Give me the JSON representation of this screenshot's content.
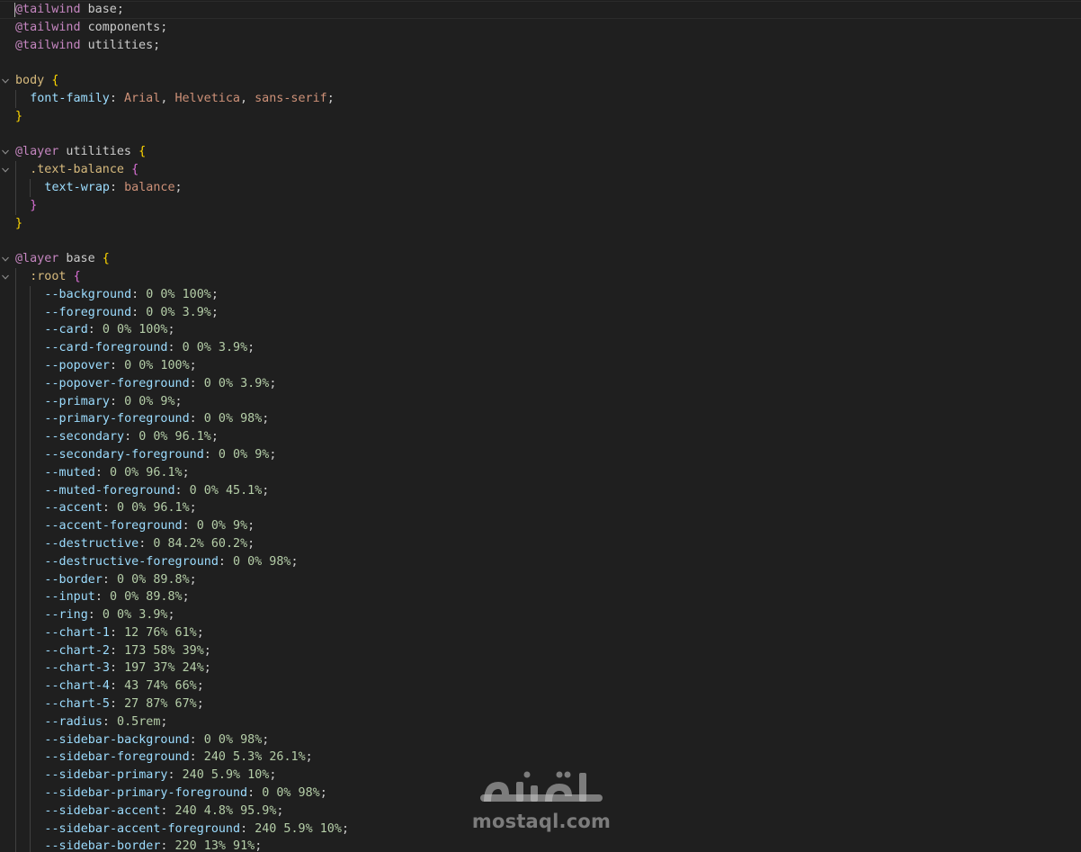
{
  "editor": {
    "language": "css",
    "colors": {
      "background": "#1f1f1f",
      "at_rule": "#c586c0",
      "selector": "#d7ba7d",
      "property": "#9cdcfe",
      "string_value": "#ce9178",
      "number": "#b5cea8",
      "bracket_level_1": "#ffd700",
      "bracket_level_2": "#da70d6"
    },
    "lines": [
      {
        "indent": 0,
        "fold": false,
        "cursor": true,
        "tokens": [
          {
            "t": "@tailwind",
            "c": "kw"
          },
          {
            "t": " base;",
            "c": "plain"
          }
        ]
      },
      {
        "indent": 0,
        "fold": false,
        "tokens": [
          {
            "t": "@tailwind",
            "c": "kw"
          },
          {
            "t": " components;",
            "c": "plain"
          }
        ]
      },
      {
        "indent": 0,
        "fold": false,
        "tokens": [
          {
            "t": "@tailwind",
            "c": "kw"
          },
          {
            "t": " utilities;",
            "c": "plain"
          }
        ]
      },
      {
        "indent": 0,
        "fold": false,
        "tokens": []
      },
      {
        "indent": 0,
        "fold": true,
        "tokens": [
          {
            "t": "body",
            "c": "sel"
          },
          {
            "t": " ",
            "c": "plain"
          },
          {
            "t": "{",
            "c": "b1"
          }
        ]
      },
      {
        "indent": 1,
        "fold": false,
        "tokens": [
          {
            "t": "font-family",
            "c": "prop"
          },
          {
            "t": ": ",
            "c": "plain"
          },
          {
            "t": "Arial",
            "c": "val"
          },
          {
            "t": ", ",
            "c": "plain"
          },
          {
            "t": "Helvetica",
            "c": "val"
          },
          {
            "t": ", ",
            "c": "plain"
          },
          {
            "t": "sans-serif",
            "c": "val"
          },
          {
            "t": ";",
            "c": "plain"
          }
        ]
      },
      {
        "indent": 0,
        "fold": false,
        "tokens": [
          {
            "t": "}",
            "c": "b1"
          }
        ]
      },
      {
        "indent": 0,
        "fold": false,
        "tokens": []
      },
      {
        "indent": 0,
        "fold": true,
        "tokens": [
          {
            "t": "@layer",
            "c": "kw"
          },
          {
            "t": " utilities ",
            "c": "plain"
          },
          {
            "t": "{",
            "c": "b1"
          }
        ]
      },
      {
        "indent": 1,
        "fold": true,
        "tokens": [
          {
            "t": ".text-balance",
            "c": "sel"
          },
          {
            "t": " ",
            "c": "plain"
          },
          {
            "t": "{",
            "c": "b2"
          }
        ]
      },
      {
        "indent": 2,
        "fold": false,
        "tokens": [
          {
            "t": "text-wrap",
            "c": "prop"
          },
          {
            "t": ": ",
            "c": "plain"
          },
          {
            "t": "balance",
            "c": "val"
          },
          {
            "t": ";",
            "c": "plain"
          }
        ]
      },
      {
        "indent": 1,
        "fold": false,
        "tokens": [
          {
            "t": "}",
            "c": "b2"
          }
        ]
      },
      {
        "indent": 0,
        "fold": false,
        "tokens": [
          {
            "t": "}",
            "c": "b1"
          }
        ]
      },
      {
        "indent": 0,
        "fold": false,
        "tokens": []
      },
      {
        "indent": 0,
        "fold": true,
        "tokens": [
          {
            "t": "@layer",
            "c": "kw"
          },
          {
            "t": " base ",
            "c": "plain"
          },
          {
            "t": "{",
            "c": "b1"
          }
        ]
      },
      {
        "indent": 1,
        "fold": true,
        "tokens": [
          {
            "t": ":root",
            "c": "sel"
          },
          {
            "t": " ",
            "c": "plain"
          },
          {
            "t": "{",
            "c": "b2"
          }
        ]
      },
      {
        "indent": 2,
        "fold": false,
        "tokens": [
          {
            "t": "--background",
            "c": "prop"
          },
          {
            "t": ": ",
            "c": "plain"
          },
          {
            "t": "0 0% 100%",
            "c": "num"
          },
          {
            "t": ";",
            "c": "plain"
          }
        ]
      },
      {
        "indent": 2,
        "fold": false,
        "tokens": [
          {
            "t": "--foreground",
            "c": "prop"
          },
          {
            "t": ": ",
            "c": "plain"
          },
          {
            "t": "0 0% 3.9%",
            "c": "num"
          },
          {
            "t": ";",
            "c": "plain"
          }
        ]
      },
      {
        "indent": 2,
        "fold": false,
        "tokens": [
          {
            "t": "--card",
            "c": "prop"
          },
          {
            "t": ": ",
            "c": "plain"
          },
          {
            "t": "0 0% 100%",
            "c": "num"
          },
          {
            "t": ";",
            "c": "plain"
          }
        ]
      },
      {
        "indent": 2,
        "fold": false,
        "tokens": [
          {
            "t": "--card-foreground",
            "c": "prop"
          },
          {
            "t": ": ",
            "c": "plain"
          },
          {
            "t": "0 0% 3.9%",
            "c": "num"
          },
          {
            "t": ";",
            "c": "plain"
          }
        ]
      },
      {
        "indent": 2,
        "fold": false,
        "tokens": [
          {
            "t": "--popover",
            "c": "prop"
          },
          {
            "t": ": ",
            "c": "plain"
          },
          {
            "t": "0 0% 100%",
            "c": "num"
          },
          {
            "t": ";",
            "c": "plain"
          }
        ]
      },
      {
        "indent": 2,
        "fold": false,
        "tokens": [
          {
            "t": "--popover-foreground",
            "c": "prop"
          },
          {
            "t": ": ",
            "c": "plain"
          },
          {
            "t": "0 0% 3.9%",
            "c": "num"
          },
          {
            "t": ";",
            "c": "plain"
          }
        ]
      },
      {
        "indent": 2,
        "fold": false,
        "tokens": [
          {
            "t": "--primary",
            "c": "prop"
          },
          {
            "t": ": ",
            "c": "plain"
          },
          {
            "t": "0 0% 9%",
            "c": "num"
          },
          {
            "t": ";",
            "c": "plain"
          }
        ]
      },
      {
        "indent": 2,
        "fold": false,
        "tokens": [
          {
            "t": "--primary-foreground",
            "c": "prop"
          },
          {
            "t": ": ",
            "c": "plain"
          },
          {
            "t": "0 0% 98%",
            "c": "num"
          },
          {
            "t": ";",
            "c": "plain"
          }
        ]
      },
      {
        "indent": 2,
        "fold": false,
        "tokens": [
          {
            "t": "--secondary",
            "c": "prop"
          },
          {
            "t": ": ",
            "c": "plain"
          },
          {
            "t": "0 0% 96.1%",
            "c": "num"
          },
          {
            "t": ";",
            "c": "plain"
          }
        ]
      },
      {
        "indent": 2,
        "fold": false,
        "tokens": [
          {
            "t": "--secondary-foreground",
            "c": "prop"
          },
          {
            "t": ": ",
            "c": "plain"
          },
          {
            "t": "0 0% 9%",
            "c": "num"
          },
          {
            "t": ";",
            "c": "plain"
          }
        ]
      },
      {
        "indent": 2,
        "fold": false,
        "tokens": [
          {
            "t": "--muted",
            "c": "prop"
          },
          {
            "t": ": ",
            "c": "plain"
          },
          {
            "t": "0 0% 96.1%",
            "c": "num"
          },
          {
            "t": ";",
            "c": "plain"
          }
        ]
      },
      {
        "indent": 2,
        "fold": false,
        "tokens": [
          {
            "t": "--muted-foreground",
            "c": "prop"
          },
          {
            "t": ": ",
            "c": "plain"
          },
          {
            "t": "0 0% 45.1%",
            "c": "num"
          },
          {
            "t": ";",
            "c": "plain"
          }
        ]
      },
      {
        "indent": 2,
        "fold": false,
        "tokens": [
          {
            "t": "--accent",
            "c": "prop"
          },
          {
            "t": ": ",
            "c": "plain"
          },
          {
            "t": "0 0% 96.1%",
            "c": "num"
          },
          {
            "t": ";",
            "c": "plain"
          }
        ]
      },
      {
        "indent": 2,
        "fold": false,
        "tokens": [
          {
            "t": "--accent-foreground",
            "c": "prop"
          },
          {
            "t": ": ",
            "c": "plain"
          },
          {
            "t": "0 0% 9%",
            "c": "num"
          },
          {
            "t": ";",
            "c": "plain"
          }
        ]
      },
      {
        "indent": 2,
        "fold": false,
        "tokens": [
          {
            "t": "--destructive",
            "c": "prop"
          },
          {
            "t": ": ",
            "c": "plain"
          },
          {
            "t": "0 84.2% 60.2%",
            "c": "num"
          },
          {
            "t": ";",
            "c": "plain"
          }
        ]
      },
      {
        "indent": 2,
        "fold": false,
        "tokens": [
          {
            "t": "--destructive-foreground",
            "c": "prop"
          },
          {
            "t": ": ",
            "c": "plain"
          },
          {
            "t": "0 0% 98%",
            "c": "num"
          },
          {
            "t": ";",
            "c": "plain"
          }
        ]
      },
      {
        "indent": 2,
        "fold": false,
        "tokens": [
          {
            "t": "--border",
            "c": "prop"
          },
          {
            "t": ": ",
            "c": "plain"
          },
          {
            "t": "0 0% 89.8%",
            "c": "num"
          },
          {
            "t": ";",
            "c": "plain"
          }
        ]
      },
      {
        "indent": 2,
        "fold": false,
        "tokens": [
          {
            "t": "--input",
            "c": "prop"
          },
          {
            "t": ": ",
            "c": "plain"
          },
          {
            "t": "0 0% 89.8%",
            "c": "num"
          },
          {
            "t": ";",
            "c": "plain"
          }
        ]
      },
      {
        "indent": 2,
        "fold": false,
        "tokens": [
          {
            "t": "--ring",
            "c": "prop"
          },
          {
            "t": ": ",
            "c": "plain"
          },
          {
            "t": "0 0% 3.9%",
            "c": "num"
          },
          {
            "t": ";",
            "c": "plain"
          }
        ]
      },
      {
        "indent": 2,
        "fold": false,
        "tokens": [
          {
            "t": "--chart-1",
            "c": "prop"
          },
          {
            "t": ": ",
            "c": "plain"
          },
          {
            "t": "12 76% 61%",
            "c": "num"
          },
          {
            "t": ";",
            "c": "plain"
          }
        ]
      },
      {
        "indent": 2,
        "fold": false,
        "tokens": [
          {
            "t": "--chart-2",
            "c": "prop"
          },
          {
            "t": ": ",
            "c": "plain"
          },
          {
            "t": "173 58% 39%",
            "c": "num"
          },
          {
            "t": ";",
            "c": "plain"
          }
        ]
      },
      {
        "indent": 2,
        "fold": false,
        "tokens": [
          {
            "t": "--chart-3",
            "c": "prop"
          },
          {
            "t": ": ",
            "c": "plain"
          },
          {
            "t": "197 37% 24%",
            "c": "num"
          },
          {
            "t": ";",
            "c": "plain"
          }
        ]
      },
      {
        "indent": 2,
        "fold": false,
        "tokens": [
          {
            "t": "--chart-4",
            "c": "prop"
          },
          {
            "t": ": ",
            "c": "plain"
          },
          {
            "t": "43 74% 66%",
            "c": "num"
          },
          {
            "t": ";",
            "c": "plain"
          }
        ]
      },
      {
        "indent": 2,
        "fold": false,
        "tokens": [
          {
            "t": "--chart-5",
            "c": "prop"
          },
          {
            "t": ": ",
            "c": "plain"
          },
          {
            "t": "27 87% 67%",
            "c": "num"
          },
          {
            "t": ";",
            "c": "plain"
          }
        ]
      },
      {
        "indent": 2,
        "fold": false,
        "tokens": [
          {
            "t": "--radius",
            "c": "prop"
          },
          {
            "t": ": ",
            "c": "plain"
          },
          {
            "t": "0.5rem",
            "c": "num"
          },
          {
            "t": ";",
            "c": "plain"
          }
        ]
      },
      {
        "indent": 2,
        "fold": false,
        "tokens": [
          {
            "t": "--sidebar-background",
            "c": "prop"
          },
          {
            "t": ": ",
            "c": "plain"
          },
          {
            "t": "0 0% 98%",
            "c": "num"
          },
          {
            "t": ";",
            "c": "plain"
          }
        ]
      },
      {
        "indent": 2,
        "fold": false,
        "tokens": [
          {
            "t": "--sidebar-foreground",
            "c": "prop"
          },
          {
            "t": ": ",
            "c": "plain"
          },
          {
            "t": "240 5.3% 26.1%",
            "c": "num"
          },
          {
            "t": ";",
            "c": "plain"
          }
        ]
      },
      {
        "indent": 2,
        "fold": false,
        "tokens": [
          {
            "t": "--sidebar-primary",
            "c": "prop"
          },
          {
            "t": ": ",
            "c": "plain"
          },
          {
            "t": "240 5.9% 10%",
            "c": "num"
          },
          {
            "t": ";",
            "c": "plain"
          }
        ]
      },
      {
        "indent": 2,
        "fold": false,
        "tokens": [
          {
            "t": "--sidebar-primary-foreground",
            "c": "prop"
          },
          {
            "t": ": ",
            "c": "plain"
          },
          {
            "t": "0 0% 98%",
            "c": "num"
          },
          {
            "t": ";",
            "c": "plain"
          }
        ]
      },
      {
        "indent": 2,
        "fold": false,
        "tokens": [
          {
            "t": "--sidebar-accent",
            "c": "prop"
          },
          {
            "t": ": ",
            "c": "plain"
          },
          {
            "t": "240 4.8% 95.9%",
            "c": "num"
          },
          {
            "t": ";",
            "c": "plain"
          }
        ]
      },
      {
        "indent": 2,
        "fold": false,
        "tokens": [
          {
            "t": "--sidebar-accent-foreground",
            "c": "prop"
          },
          {
            "t": ": ",
            "c": "plain"
          },
          {
            "t": "240 5.9% 10%",
            "c": "num"
          },
          {
            "t": ";",
            "c": "plain"
          }
        ]
      },
      {
        "indent": 2,
        "fold": false,
        "tokens": [
          {
            "t": "--sidebar-border",
            "c": "prop"
          },
          {
            "t": ": ",
            "c": "plain"
          },
          {
            "t": "220 13% 91%",
            "c": "num"
          },
          {
            "t": ";",
            "c": "plain"
          }
        ]
      }
    ]
  },
  "watermark": {
    "logo_text": "مستقل",
    "url_text": "mostaql.com",
    "color": "#c8c8c8"
  }
}
